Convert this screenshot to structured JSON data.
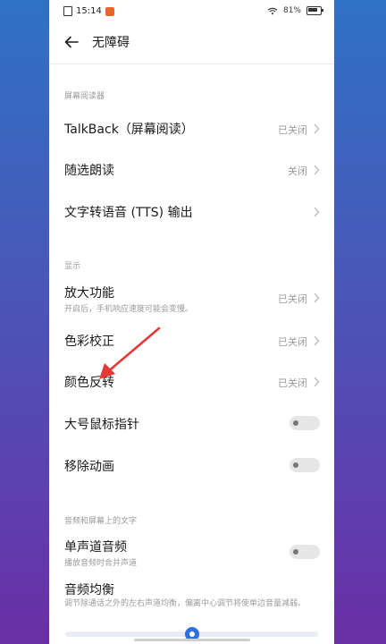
{
  "status_bar": {
    "time": "15:14",
    "battery": "81%"
  },
  "header": {
    "title": "无障碍"
  },
  "sections": [
    {
      "title": "屏幕阅读器",
      "items": [
        {
          "label": "TalkBack（屏幕阅读）",
          "status": "已关闭"
        },
        {
          "label": "随选朗读",
          "status": "关闭"
        },
        {
          "label": "文字转语音 (TTS) 输出",
          "status": ""
        }
      ]
    },
    {
      "title": "显示",
      "items": [
        {
          "label": "放大功能",
          "sub": "开启后，手机响应速度可能会变慢。",
          "status": "已关闭"
        },
        {
          "label": "色彩校正",
          "status": "已关闭"
        },
        {
          "label": "颜色反转",
          "status": "已关闭"
        },
        {
          "label": "大号鼠标指针",
          "toggle": false
        },
        {
          "label": "移除动画",
          "toggle": false
        }
      ]
    },
    {
      "title": "音频和屏幕上的文字",
      "items": [
        {
          "label": "单声道音频",
          "sub": "播放音频时合并声道",
          "toggle": false
        },
        {
          "label": "音频均衡",
          "sub": "调节除通话之外的左右声道均衡，偏离中心调节将使单边音量减弱。"
        }
      ]
    }
  ],
  "balance_slider": {
    "value": 0.5
  },
  "colors": {
    "accent": "#2f6fe0",
    "annotation_arrow": "#e53935"
  }
}
